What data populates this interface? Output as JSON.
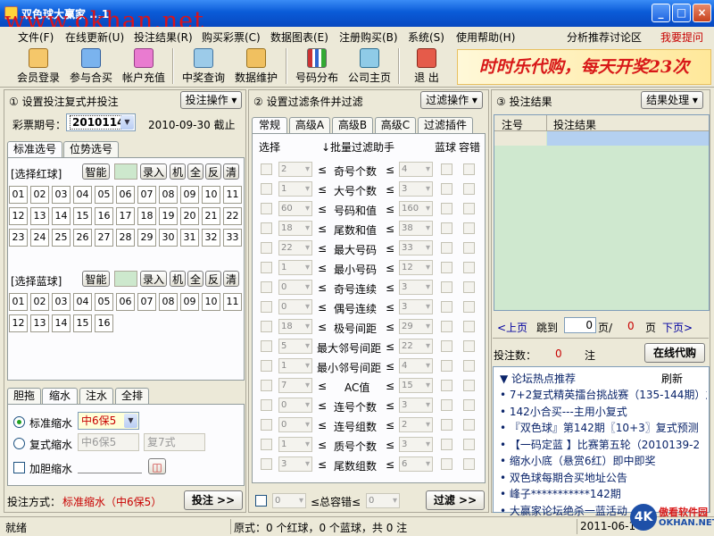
{
  "window": {
    "title": "双色球大赢家 ...1",
    "watermark": "www.okhan.net",
    "min": "_",
    "max": "□",
    "close": "×"
  },
  "menu": [
    "文件(F)",
    "在线更新(U)",
    "投注结果(R)",
    "购买彩票(C)",
    "数据图表(E)",
    "注册购买(B)",
    "系统(S)",
    "使用帮助(H)"
  ],
  "menu_right": {
    "forum": "分析推荐讨论区",
    "ask": "我要提问"
  },
  "toolbar": [
    "会员登录",
    "参与合买",
    "帐户充值",
    "中奖查询",
    "数据维护",
    "号码分布",
    "公司主页",
    "退 出"
  ],
  "banner": "时时乐代购，每天开奖23次",
  "left": {
    "header": "① 设置投注复式并投注",
    "op_button": "投注操作",
    "period_label": "彩票期号：",
    "period_value": "2010114",
    "deadline": "2010-09-30 截止",
    "tabs": [
      "标准选号",
      "位势选号"
    ],
    "red_label": "[选择红球]",
    "blue_label": "[选择蓝球]",
    "smart": "智能",
    "enter": "录入",
    "machine": "机",
    "all": "全",
    "invert": "反",
    "clear": "清",
    "red_numbers": [
      "01",
      "02",
      "03",
      "04",
      "05",
      "06",
      "07",
      "08",
      "09",
      "10",
      "11",
      "12",
      "13",
      "14",
      "15",
      "16",
      "17",
      "18",
      "19",
      "20",
      "21",
      "22",
      "23",
      "24",
      "25",
      "26",
      "27",
      "28",
      "29",
      "30",
      "31",
      "32",
      "33"
    ],
    "blue_numbers": [
      "01",
      "02",
      "03",
      "04",
      "05",
      "06",
      "07",
      "08",
      "09",
      "10",
      "11",
      "12",
      "13",
      "14",
      "15",
      "16"
    ],
    "lower_tabs": [
      "胆拖",
      "缩水",
      "注水",
      "全排"
    ],
    "std_reduce": "标准缩水",
    "std_reduce_value": "中6保5",
    "multi_reduce": "复式缩水",
    "multi_reduce_value": "中6保5",
    "multi_reduce_type": "复7式",
    "bold_reduce": "加胆缩水",
    "bet_mode_label": "投注方式：",
    "bet_mode_value": "标准缩水（中6保5）",
    "bet_button": "投注 >>"
  },
  "mid": {
    "header": "② 设置过滤条件并过滤",
    "op_button": "过滤操作",
    "tabs": [
      "常规",
      "高级A",
      "高级B",
      "高级C",
      "过滤插件"
    ],
    "col_select": "选择",
    "col_helper": "↓批量过滤助手",
    "col_blue": "蓝球",
    "col_tol": "容错",
    "rows": [
      {
        "min": "2",
        "label": "奇号个数",
        "max": "4"
      },
      {
        "min": "1",
        "label": "大号个数",
        "max": "3"
      },
      {
        "min": "60",
        "label": "号码和值",
        "max": "160"
      },
      {
        "min": "18",
        "label": "尾数和值",
        "max": "38"
      },
      {
        "min": "22",
        "label": "最大号码",
        "max": "33"
      },
      {
        "min": "1",
        "label": "最小号码",
        "max": "12"
      },
      {
        "min": "0",
        "label": "奇号连续",
        "max": "3"
      },
      {
        "min": "0",
        "label": "偶号连续",
        "max": "3"
      },
      {
        "min": "18",
        "label": "极号间距",
        "max": "29"
      },
      {
        "min": "5",
        "label": "最大邻号间距",
        "max": "22"
      },
      {
        "min": "1",
        "label": "最小邻号间距",
        "max": "4"
      },
      {
        "min": "7",
        "label": "AC值",
        "max": "15"
      },
      {
        "min": "0",
        "label": "连号个数",
        "max": "3"
      },
      {
        "min": "0",
        "label": "连号组数",
        "max": "2"
      },
      {
        "min": "1",
        "label": "质号个数",
        "max": "3"
      },
      {
        "min": "3",
        "label": "尾数组数",
        "max": "6"
      }
    ],
    "le": "≤",
    "total_tol": "≤总容错≤",
    "total_min": "0",
    "total_max": "0",
    "filter_button": "过滤 >>"
  },
  "right": {
    "header": "③ 投注结果",
    "op_button": "结果处理",
    "col_no": "注号",
    "col_result": "投注结果",
    "prev": "<上页",
    "jump": "跳到",
    "page_input": "0",
    "page_sep": "页/",
    "page_total": "0",
    "page_word": "页",
    "next": "下页>",
    "count_label": "投注数：",
    "count_value": "0",
    "count_unit": "注",
    "buy_button": "在线代购",
    "forum_title": "▼ 论坛热点推荐",
    "refresh": "刷新",
    "news": [
      "7+2复式精英擂台挑战赛（135-144期）之",
      "142小合买---主用小复式",
      "『双色球』第142期〖10+3〗复式预测",
      "【一码定蓝 】比赛第五轮（2010139-2",
      "缩水小底（悬赏6红）即中即奖",
      "双色球每期合买地址公告",
      "峰子***********142期",
      "大赢家论坛绝杀一蓝活动"
    ]
  },
  "status": {
    "ready": "就绪",
    "summary": "原式：0 个红球，0 个蓝球，共 0 注",
    "date": "2011-06-14",
    "logo_text": "傲看软件园",
    "logo_url": "OKHAN.NET"
  }
}
